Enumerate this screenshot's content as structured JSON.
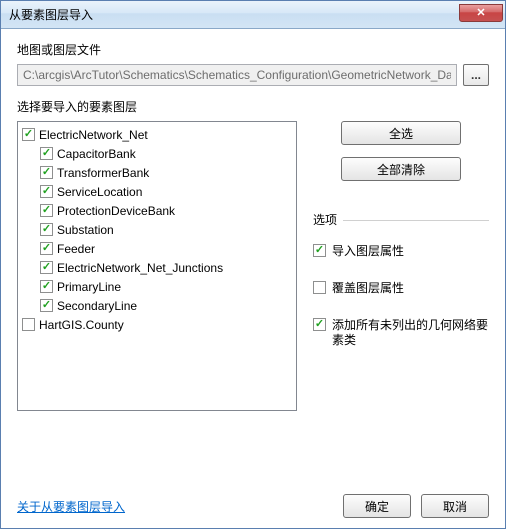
{
  "title": "从要素图层导入",
  "close_icon": "✕",
  "map_section": {
    "label": "地图或图层文件",
    "path": "C:\\arcgis\\ArcTutor\\Schematics\\Schematics_Configuration\\GeometricNetwork_Data\\Ma",
    "browse_label": "..."
  },
  "select_section": {
    "label": "选择要导入的要素图层",
    "items": [
      {
        "label": "ElectricNetwork_Net",
        "checked": true,
        "indent": 0
      },
      {
        "label": "CapacitorBank",
        "checked": true,
        "indent": 1
      },
      {
        "label": "TransformerBank",
        "checked": true,
        "indent": 1
      },
      {
        "label": "ServiceLocation",
        "checked": true,
        "indent": 1
      },
      {
        "label": "ProtectionDeviceBank",
        "checked": true,
        "indent": 1
      },
      {
        "label": "Substation",
        "checked": true,
        "indent": 1
      },
      {
        "label": "Feeder",
        "checked": true,
        "indent": 1
      },
      {
        "label": "ElectricNetwork_Net_Junctions",
        "checked": true,
        "indent": 1
      },
      {
        "label": "PrimaryLine",
        "checked": true,
        "indent": 1
      },
      {
        "label": "SecondaryLine",
        "checked": true,
        "indent": 1
      },
      {
        "label": "HartGIS.County",
        "checked": false,
        "indent": 0
      }
    ]
  },
  "buttons": {
    "select_all": "全选",
    "clear_all": "全部清除",
    "ok": "确定",
    "cancel": "取消"
  },
  "options": {
    "title": "选项",
    "items": [
      {
        "label": "导入图层属性",
        "checked": true
      },
      {
        "label": "覆盖图层属性",
        "checked": false
      },
      {
        "label": "添加所有未列出的几何网络要素类",
        "checked": true
      }
    ]
  },
  "help_link": "关于从要素图层导入"
}
